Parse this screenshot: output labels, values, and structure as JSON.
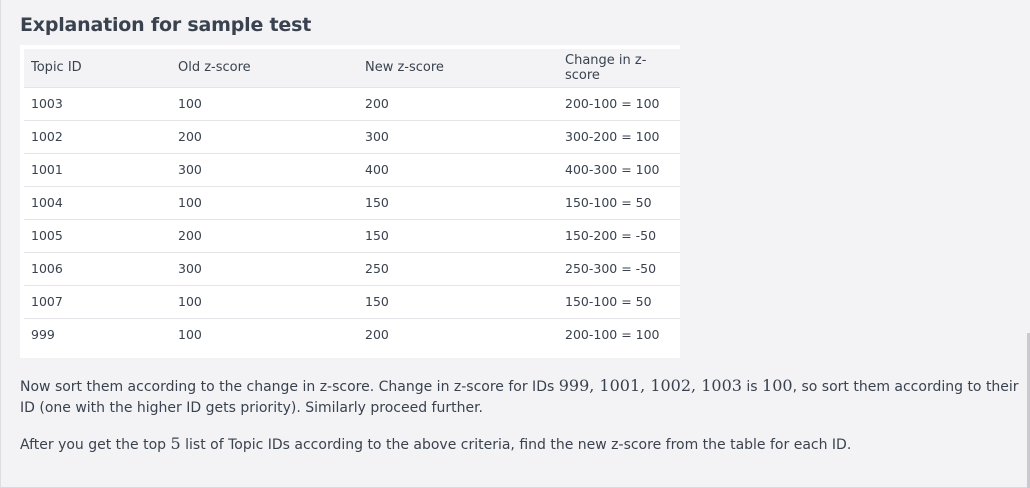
{
  "section": {
    "heading": "Explanation for sample test"
  },
  "table": {
    "headers": [
      "Topic ID",
      "Old z-score",
      "New z-score",
      "Change in z-score"
    ],
    "rows": [
      [
        "1003",
        "100",
        "200",
        "200-100 = 100"
      ],
      [
        "1002",
        "200",
        "300",
        "300-200 = 100"
      ],
      [
        "1001",
        "300",
        "400",
        "400-300 = 100"
      ],
      [
        "1004",
        "100",
        "150",
        "150-100 = 50"
      ],
      [
        "1005",
        "200",
        "150",
        "150-200 = -50"
      ],
      [
        "1006",
        "300",
        "250",
        "250-300 = -50"
      ],
      [
        "1007",
        "100",
        "150",
        "150-100 = 50"
      ],
      [
        "999",
        "100",
        "200",
        "200-100 = 100"
      ]
    ]
  },
  "paragraph1": {
    "t1": "Now sort them according to the change in z-score. Change in z-score for IDs ",
    "m1": "999, 1001, 1002, 1003",
    "t2": " is ",
    "m2": "100",
    "t3": ", so sort them according to their ID (one with the higher ID gets priority). Similarly proceed further."
  },
  "paragraph2": {
    "t1": "After you get the top ",
    "m1": "5",
    "t2": " list of Topic IDs according to the above criteria, find the new z-score from the table for each ID."
  }
}
